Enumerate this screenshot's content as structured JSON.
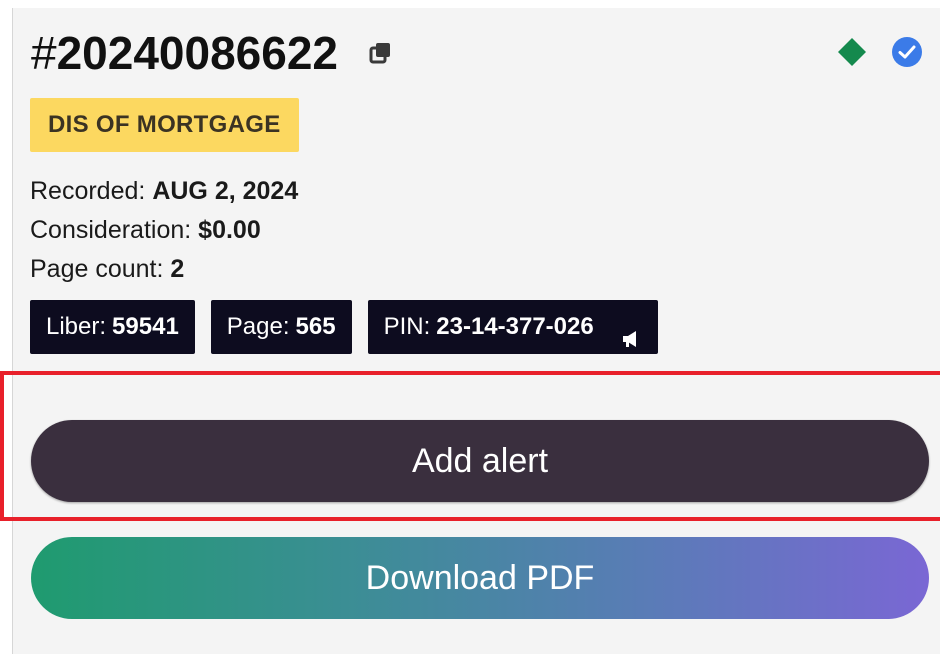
{
  "record": {
    "hash": "#",
    "number": "20240086622",
    "document_type": "DIS OF MORTGAGE",
    "recorded_label": "Recorded:",
    "recorded_value": "AUG 2, 2024",
    "consideration_label": "Consideration:",
    "consideration_value": "$0.00",
    "page_count_label": "Page count:",
    "page_count_value": "2"
  },
  "chips": {
    "liber_label": "Liber:",
    "liber_value": "59541",
    "page_label": "Page:",
    "page_value": "565",
    "pin_label": "PIN:",
    "pin_value": "23-14-377-026"
  },
  "actions": {
    "add_alert_label": "Add alert",
    "download_pdf_label": "Download PDF"
  },
  "icons": {
    "copy": "copy-icon",
    "status_diamond": "diamond-icon",
    "verified": "check-circle-icon",
    "pin_action": "megaphone-icon"
  },
  "colors": {
    "doc_type_bg": "#fcd860",
    "chip_bg": "#0d0c1f",
    "diamond": "#14894d",
    "verified": "#3b7be8",
    "add_alert_bg": "#3a2f3e",
    "highlight_border": "#e8202a",
    "download_gradient_start": "#1f9b6f",
    "download_gradient_end": "#7a67d4"
  }
}
